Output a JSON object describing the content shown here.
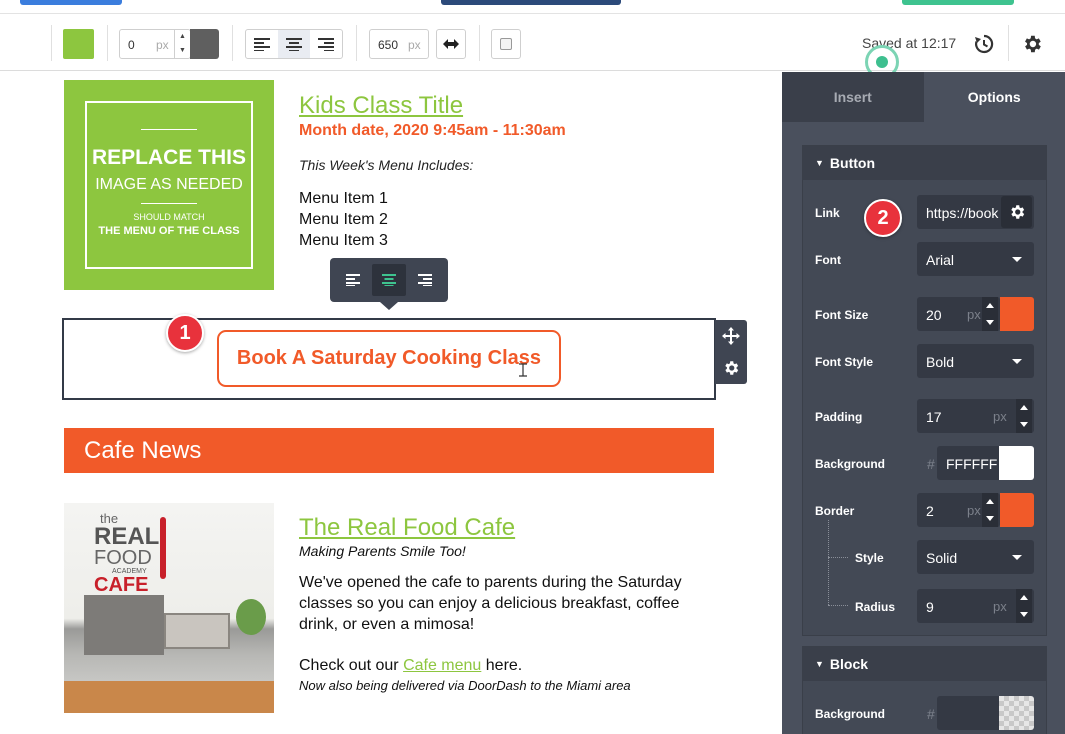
{
  "toolbar": {
    "border_width_value": "0",
    "border_width_unit": "px",
    "width_value": "650",
    "width_unit": "px",
    "saved_text": "Saved at 12:17",
    "colors": {
      "green": "#8dc63f",
      "dark": "#5f5f5f"
    }
  },
  "kids": {
    "image_line1": "REPLACE THIS",
    "image_line2": "IMAGE AS NEEDED",
    "image_line3": "SHOULD MATCH",
    "image_line4": "THE MENU OF THE CLASS",
    "title": "Kids Class Title",
    "date": "Month date, 2020 9:45am - 11:30am",
    "week_heading": "This Week's Menu Includes:",
    "menu_items": [
      "Menu Item 1",
      "Menu Item 2",
      "Menu Item 3"
    ]
  },
  "button_block": {
    "label": "Book A Saturday Cooking Class"
  },
  "badges": {
    "one": "1",
    "two": "2"
  },
  "news": {
    "heading": "Cafe News"
  },
  "cafe": {
    "image_word1": "the",
    "image_word2": "REAL",
    "image_word3": "FOOD",
    "image_word4": "ACADEMY",
    "image_word5": "CAFE",
    "title": "The Real Food Cafe",
    "subtitle": "Making Parents Smile Too!",
    "body": "We've opened the cafe to parents during the Saturday classes so you can enjoy a delicious breakfast, coffee drink, or even a mimosa!",
    "check_prefix": "Check out our ",
    "check_link": "Cafe menu",
    "check_suffix": " here.",
    "doordash": "Now also being delivered via DoorDash to the Miami area"
  },
  "panel": {
    "tab_insert": "Insert",
    "tab_options": "Options",
    "button_section": {
      "title": "Button",
      "link_label": "Link",
      "link_value": "https://book",
      "font_label": "Font",
      "font_value": "Arial",
      "font_size_label": "Font Size",
      "font_size_value": "20",
      "font_size_unit": "px",
      "font_style_label": "Font Style",
      "font_style_value": "Bold",
      "padding_label": "Padding",
      "padding_value": "17",
      "padding_unit": "px",
      "background_label": "Background",
      "background_hash": "#",
      "background_value": "FFFFFF",
      "border_label": "Border",
      "border_value": "2",
      "border_unit": "px",
      "style_label": "Style",
      "style_value": "Solid",
      "radius_label": "Radius",
      "radius_value": "9",
      "radius_unit": "px"
    },
    "block_section": {
      "title": "Block",
      "background_label": "Background",
      "background_hash": "#"
    }
  },
  "colors": {
    "accent": "#f15a29",
    "brand_green": "#8dc63f",
    "panel": "#4a505d",
    "badge": "#e8323c"
  }
}
